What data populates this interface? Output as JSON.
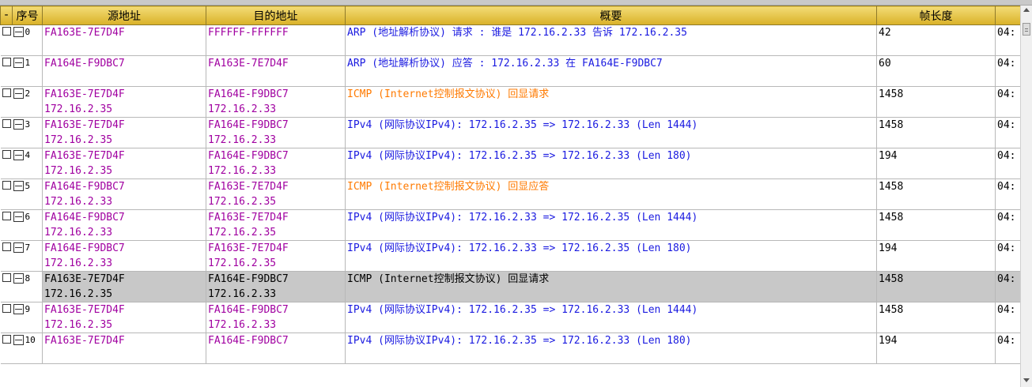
{
  "columns": {
    "toggle": "-",
    "index": "序号",
    "source": "源地址",
    "destination": "目的地址",
    "summary": "概要",
    "length": "帧长度",
    "time": ""
  },
  "colors": {
    "header_gold": "#e8c84a",
    "selected_row": "#c8c8c8",
    "mac_text": "#a000a0",
    "ip_text": "#1a1ae0",
    "icmp_text": "#ff7a00"
  },
  "rows": [
    {
      "index": "0",
      "src_mac": "FA163E-7E7D4F",
      "src_ip": "",
      "dst_mac": "FFFFFF-FFFFFF",
      "dst_ip": "",
      "summary": "ARP (地址解析协议) 请求 : 谁是 172.16.2.33 告诉 172.16.2.35",
      "length": "42",
      "time": "04:",
      "summary_color": "blue",
      "selected": false
    },
    {
      "index": "1",
      "src_mac": "FA164E-F9DBC7",
      "src_ip": "",
      "dst_mac": "FA163E-7E7D4F",
      "dst_ip": "",
      "summary": "ARP (地址解析协议) 应答 : 172.16.2.33 在 FA164E-F9DBC7",
      "length": "60",
      "time": "04:",
      "summary_color": "blue",
      "selected": false
    },
    {
      "index": "2",
      "src_mac": "FA163E-7E7D4F",
      "src_ip": "172.16.2.35",
      "dst_mac": "FA164E-F9DBC7",
      "dst_ip": "172.16.2.33",
      "summary": "ICMP (Internet控制报文协议) 回显请求",
      "length": "1458",
      "time": "04:",
      "summary_color": "orange",
      "selected": false
    },
    {
      "index": "3",
      "src_mac": "FA163E-7E7D4F",
      "src_ip": "172.16.2.35",
      "dst_mac": "FA164E-F9DBC7",
      "dst_ip": "172.16.2.33",
      "summary": "IPv4 (网际协议IPv4): 172.16.2.35 => 172.16.2.33 (Len 1444)",
      "length": "1458",
      "time": "04:",
      "summary_color": "blue",
      "selected": false
    },
    {
      "index": "4",
      "src_mac": "FA163E-7E7D4F",
      "src_ip": "172.16.2.35",
      "dst_mac": "FA164E-F9DBC7",
      "dst_ip": "172.16.2.33",
      "summary": "IPv4 (网际协议IPv4): 172.16.2.35 => 172.16.2.33 (Len 180)",
      "length": "194",
      "time": "04:",
      "summary_color": "blue",
      "selected": false
    },
    {
      "index": "5",
      "src_mac": "FA164E-F9DBC7",
      "src_ip": "172.16.2.33",
      "dst_mac": "FA163E-7E7D4F",
      "dst_ip": "172.16.2.35",
      "summary": "ICMP (Internet控制报文协议) 回显应答",
      "length": "1458",
      "time": "04:",
      "summary_color": "orange",
      "selected": false
    },
    {
      "index": "6",
      "src_mac": "FA164E-F9DBC7",
      "src_ip": "172.16.2.33",
      "dst_mac": "FA163E-7E7D4F",
      "dst_ip": "172.16.2.35",
      "summary": "IPv4 (网际协议IPv4): 172.16.2.33 => 172.16.2.35 (Len 1444)",
      "length": "1458",
      "time": "04:",
      "summary_color": "blue",
      "selected": false
    },
    {
      "index": "7",
      "src_mac": "FA164E-F9DBC7",
      "src_ip": "172.16.2.33",
      "dst_mac": "FA163E-7E7D4F",
      "dst_ip": "172.16.2.35",
      "summary": "IPv4 (网际协议IPv4): 172.16.2.33 => 172.16.2.35 (Len 180)",
      "length": "194",
      "time": "04:",
      "summary_color": "blue",
      "selected": false
    },
    {
      "index": "8",
      "src_mac": "FA163E-7E7D4F",
      "src_ip": "172.16.2.35",
      "dst_mac": "FA164E-F9DBC7",
      "dst_ip": "172.16.2.33",
      "summary": "ICMP (Internet控制报文协议) 回显请求",
      "length": "1458",
      "time": "04:",
      "summary_color": "black",
      "selected": true
    },
    {
      "index": "9",
      "src_mac": "FA163E-7E7D4F",
      "src_ip": "172.16.2.35",
      "dst_mac": "FA164E-F9DBC7",
      "dst_ip": "172.16.2.33",
      "summary": "IPv4 (网际协议IPv4): 172.16.2.35 => 172.16.2.33 (Len 1444)",
      "length": "1458",
      "time": "04:",
      "summary_color": "blue",
      "selected": false
    },
    {
      "index": "10",
      "src_mac": "FA163E-7E7D4F",
      "src_ip": "",
      "dst_mac": "FA164E-F9DBC7",
      "dst_ip": "",
      "summary": "IPv4 (网际协议IPv4): 172.16.2.35 => 172.16.2.33 (Len 180)",
      "length": "194",
      "time": "04:",
      "summary_color": "blue",
      "selected": false
    }
  ]
}
